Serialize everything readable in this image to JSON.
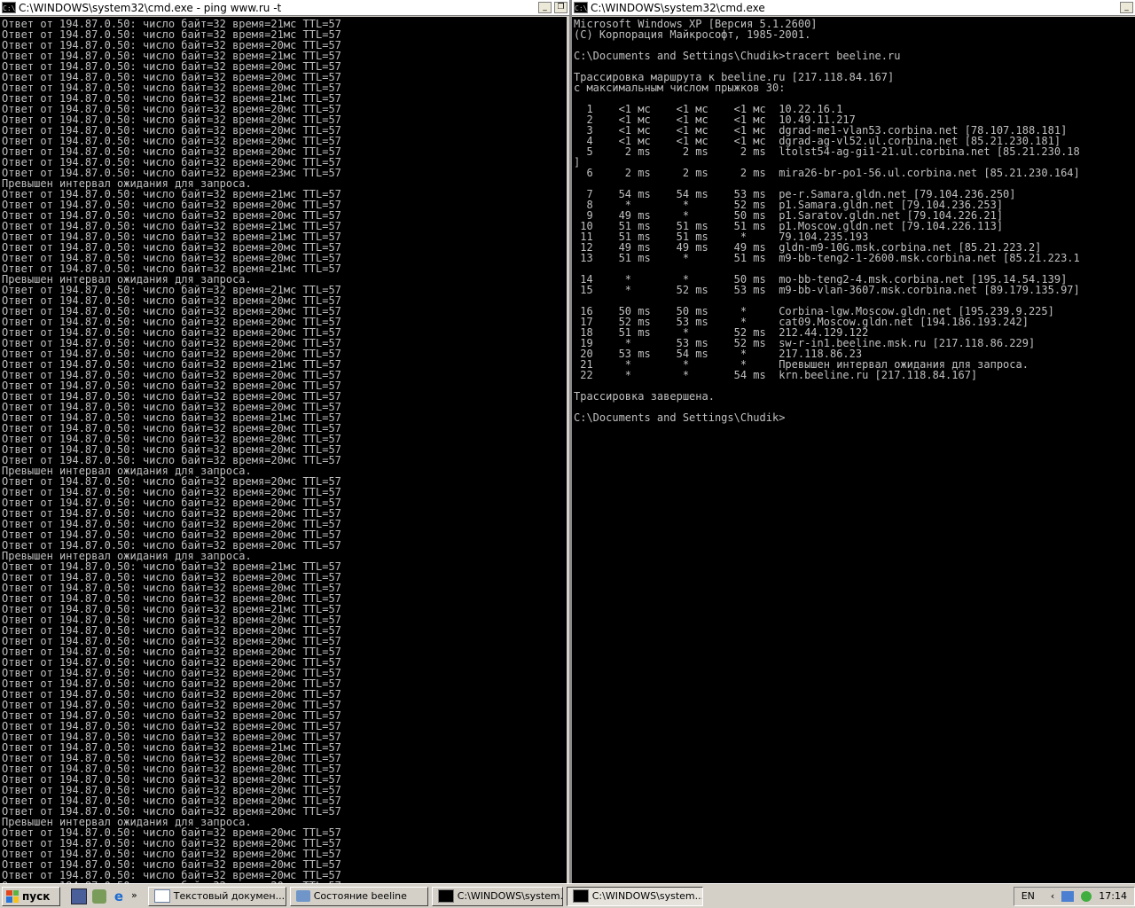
{
  "left_window": {
    "title": "C:\\WINDOWS\\system32\\cmd.exe - ping www.ru -t",
    "icon": "cmd-icon",
    "ping": {
      "prefix": "Ответ от 194.87.0.50: число байт=32 время=",
      "suffix": "мс TTL=57",
      "timeout_text": "Превышен интервал ожидания для запроса.",
      "lines": [
        21,
        21,
        20,
        21,
        20,
        20,
        20,
        21,
        20,
        20,
        20,
        20,
        20,
        20,
        23,
        "T",
        21,
        20,
        20,
        21,
        21,
        20,
        20,
        21,
        "T",
        21,
        20,
        20,
        20,
        20,
        20,
        20,
        21,
        20,
        20,
        20,
        20,
        21,
        20,
        20,
        20,
        20,
        "T",
        20,
        20,
        20,
        20,
        20,
        20,
        20,
        "T",
        21,
        20,
        20,
        20,
        21,
        20,
        20,
        20,
        20,
        20,
        20,
        20,
        20,
        20,
        20,
        20,
        20,
        21,
        20,
        20,
        20,
        20,
        20,
        20,
        "T",
        20,
        20,
        20,
        20,
        20,
        20,
        20
      ]
    }
  },
  "right_window": {
    "title": "C:\\WINDOWS\\system32\\cmd.exe",
    "icon": "cmd-icon",
    "lines": [
      "Microsoft Windows XP [Версия 5.1.2600]",
      "(С) Корпорация Майкрософт, 1985-2001.",
      "",
      "C:\\Documents and Settings\\Chudik>tracert beeline.ru",
      "",
      "Трассировка маршрута к beeline.ru [217.118.84.167]",
      "с максимальным числом прыжков 30:",
      "",
      "  1    <1 мс    <1 мс    <1 мс  10.22.16.1",
      "  2    <1 мс    <1 мс    <1 мс  10.49.11.217",
      "  3    <1 мс    <1 мс    <1 мс  dgrad-me1-vlan53.corbina.net [78.107.188.181]",
      "  4    <1 мс    <1 мс    <1 мс  dgrad-ag-vl52.ul.corbina.net [85.21.230.181]",
      "  5     2 ms     2 ms     2 ms  ltolst54-ag-gi1-21.ul.corbina.net [85.21.230.18",
      "]",
      "  6     2 ms     2 ms     2 ms  mira26-br-po1-56.ul.corbina.net [85.21.230.164]",
      "",
      "  7    54 ms    54 ms    53 ms  pe-r.Samara.gldn.net [79.104.236.250]",
      "  8     *        *       52 ms  p1.Samara.gldn.net [79.104.236.253]",
      "  9    49 ms     *       50 ms  p1.Saratov.gldn.net [79.104.226.21]",
      " 10    51 ms    51 ms    51 ms  p1.Moscow.gldn.net [79.104.226.113]",
      " 11    51 ms    51 ms     *     79.104.235.193",
      " 12    49 ms    49 ms    49 ms  gldn-m9-10G.msk.corbina.net [85.21.223.2]",
      " 13    51 ms     *       51 ms  m9-bb-teng2-1-2600.msk.corbina.net [85.21.223.1",
      "",
      " 14     *        *       50 ms  mo-bb-teng2-4.msk.corbina.net [195.14.54.139]",
      " 15     *       52 ms    53 ms  m9-bb-vlan-3607.msk.corbina.net [89.179.135.97]",
      "",
      " 16    50 ms    50 ms     *     Corbina-lgw.Moscow.gldn.net [195.239.9.225]",
      " 17    52 ms    53 ms     *     cat09.Moscow.gldn.net [194.186.193.242]",
      " 18    51 ms     *       52 ms  212.44.129.122",
      " 19     *       53 ms    52 ms  sw-r-in1.beeline.msk.ru [217.118.86.229]",
      " 20    53 ms    54 ms     *     217.118.86.23",
      " 21     *        *        *     Превышен интервал ожидания для запроса.",
      " 22     *        *       54 ms  krn.beeline.ru [217.118.84.167]",
      "",
      "Трассировка завершена.",
      "",
      "C:\\Documents and Settings\\Chudik>"
    ]
  },
  "taskbar": {
    "start_label": "пуск",
    "tasks": [
      {
        "label": "Текстовый докумен...",
        "icon": "document-icon",
        "active": false
      },
      {
        "label": "Состояние beeline",
        "icon": "network-icon",
        "active": false
      },
      {
        "label": "C:\\WINDOWS\\system...",
        "icon": "cmd-icon",
        "active": false
      },
      {
        "label": "C:\\WINDOWS\\system...",
        "icon": "cmd-icon",
        "active": true
      }
    ],
    "language": "EN",
    "clock": "17:14"
  },
  "colors": {
    "console_bg": "#000000",
    "console_text": "#c0c0c0",
    "desktop": "#3a6ea5",
    "start_green": "#3c8d3c"
  }
}
